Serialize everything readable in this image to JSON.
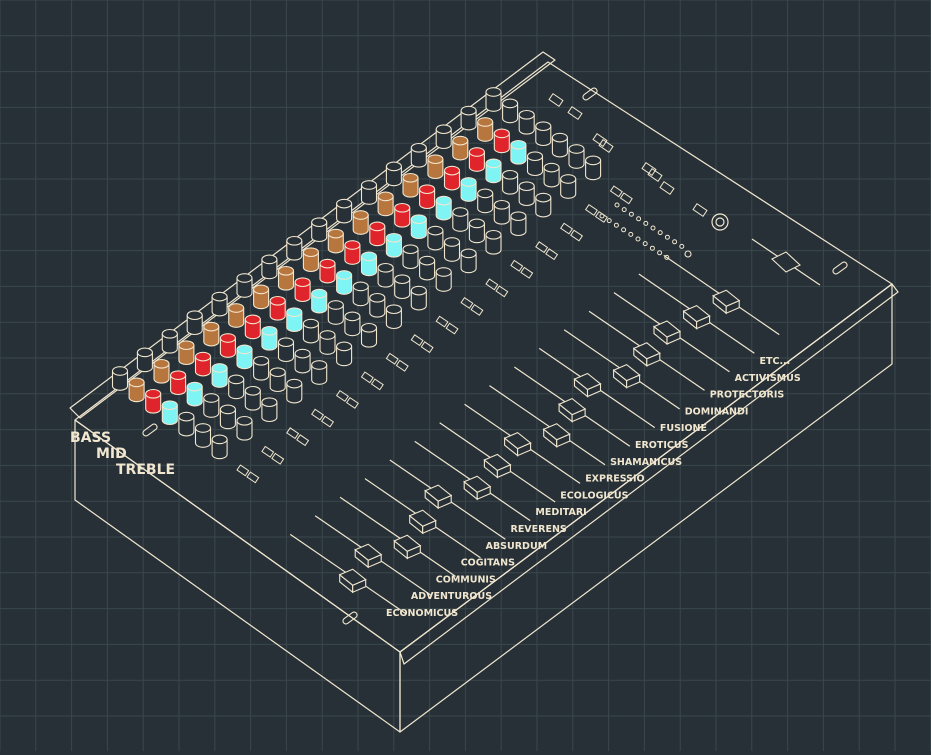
{
  "colors": {
    "background": "#263036",
    "grid": "#3a474d",
    "outline": "#f1e6cf",
    "knob_fill": "#263036",
    "bass": "#b8763f",
    "mid": "#e0242b",
    "treble": "#7ef4f4"
  },
  "eq_labels": [
    "BASS",
    "MID",
    "TREBLE"
  ],
  "channels": [
    "ECONOMICUS",
    "ADVENTUROUS",
    "COMMUNIS",
    "COGITANS",
    "ABSURDUM",
    "REVERENS",
    "MEDITARI",
    "ECOLOGICUS",
    "EXPRESSIO",
    "SHAMANICUS",
    "EROTICUS",
    "FUSIONE",
    "DOMINANDI",
    "PROTECTORIS",
    "ACTIVISMUS",
    "ETC..."
  ],
  "fader_levels": [
    0.45,
    0.55,
    0.4,
    0.5,
    0.6,
    0.45,
    0.5,
    0.55,
    0.4,
    0.5,
    0.6,
    0.45,
    0.5,
    0.55,
    0.5,
    0.45
  ]
}
